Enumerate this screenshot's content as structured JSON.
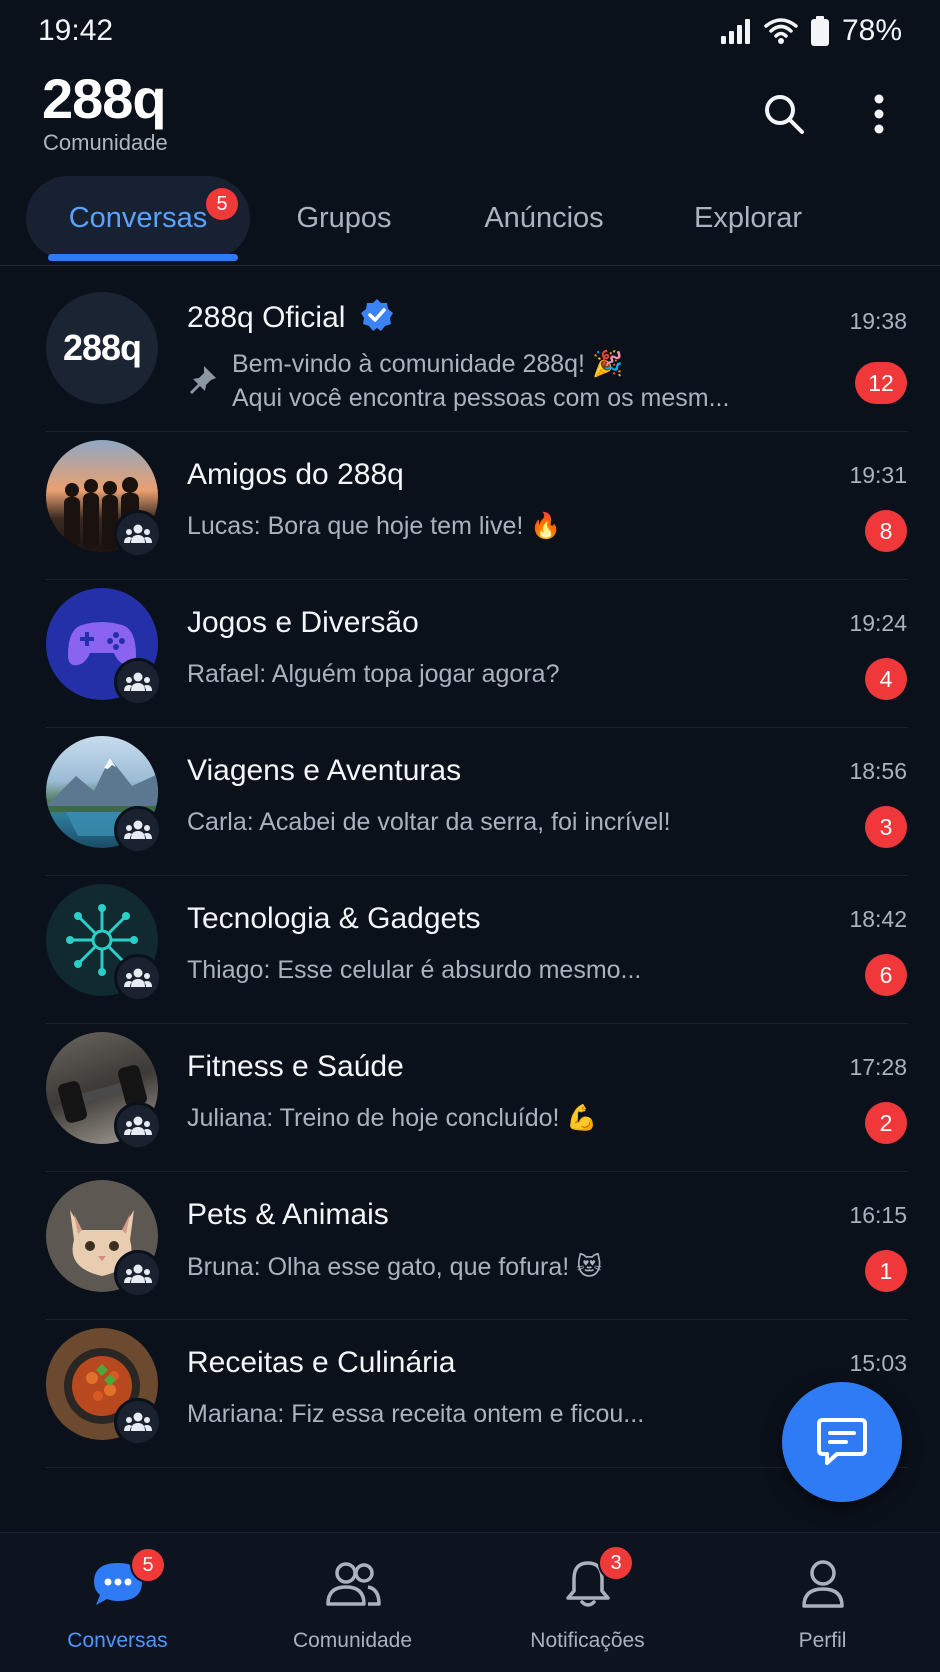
{
  "status_bar": {
    "time": "19:42",
    "battery": "78%"
  },
  "header": {
    "title": "288q",
    "subtitle": "Comunidade"
  },
  "tabs": [
    {
      "label": "Conversas",
      "badge": "5",
      "active": true
    },
    {
      "label": "Grupos"
    },
    {
      "label": "Anúncios"
    },
    {
      "label": "Explorar"
    }
  ],
  "chats": [
    {
      "name": "288q Oficial",
      "avatar_text": "288q",
      "verified": true,
      "pinned": true,
      "preview_line1": "Bem-vindo à comunidade 288q! 🎉",
      "preview_line2": "Aqui você encontra pessoas com os mesm...",
      "time": "19:38",
      "unread": "12"
    },
    {
      "name": "Amigos do 288q",
      "preview": "Lucas: Bora que hoje tem live! 🔥",
      "time": "19:31",
      "unread": "8"
    },
    {
      "name": "Jogos e Diversão",
      "preview": "Rafael: Alguém topa jogar agora?",
      "time": "19:24",
      "unread": "4"
    },
    {
      "name": "Viagens e Aventuras",
      "preview": "Carla: Acabei de voltar da serra, foi incrível!",
      "time": "18:56",
      "unread": "3"
    },
    {
      "name": "Tecnologia & Gadgets",
      "preview": "Thiago: Esse celular é absurdo mesmo...",
      "time": "18:42",
      "unread": "6"
    },
    {
      "name": "Fitness e Saúde",
      "preview": "Juliana: Treino de hoje concluído! 💪",
      "time": "17:28",
      "unread": "2"
    },
    {
      "name": "Pets & Animais",
      "preview": "Bruna: Olha esse gato, que fofura! 😻",
      "time": "16:15",
      "unread": "1"
    },
    {
      "name": "Receitas e Culinária",
      "preview": "Mariana: Fiz essa receita ontem e ficou...",
      "time": "15:03"
    }
  ],
  "bottom_nav": [
    {
      "label": "Conversas",
      "icon": "chat-bubble-icon",
      "badge": "5",
      "active": true
    },
    {
      "label": "Comunidade",
      "icon": "people-icon"
    },
    {
      "label": "Notificações",
      "icon": "bell-icon",
      "badge": "3"
    },
    {
      "label": "Perfil",
      "icon": "profile-icon"
    }
  ],
  "colors": {
    "accent": "#2f7bf5",
    "badge": "#f0383a",
    "background": "#0b111b"
  }
}
